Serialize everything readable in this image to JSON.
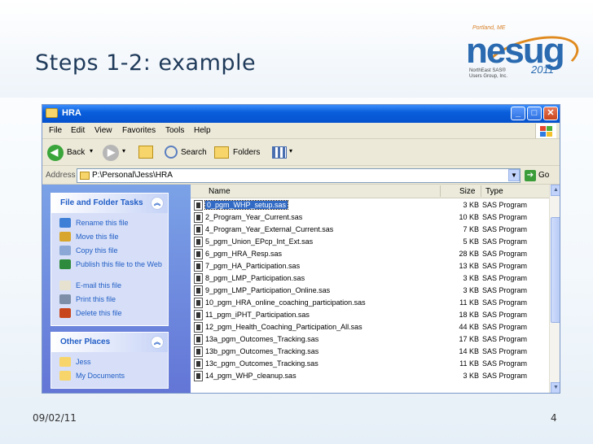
{
  "slide": {
    "title": "Steps 1-2: example",
    "date": "09/02/11",
    "page_number": "4"
  },
  "logo": {
    "city": "Portland, ME",
    "wordmark": "nesug",
    "year": "2011",
    "subtitle_line1": "NorthEast SAS®",
    "subtitle_line2": "Users Group, Inc."
  },
  "window": {
    "title": "HRA",
    "menu": [
      "File",
      "Edit",
      "View",
      "Favorites",
      "Tools",
      "Help"
    ],
    "toolbar": {
      "back": "Back",
      "search": "Search",
      "folders": "Folders"
    },
    "address": {
      "label": "Address",
      "value": "P:\\Personal\\Jess\\HRA",
      "go": "Go"
    },
    "task_panes": [
      {
        "title": "File and Folder Tasks",
        "items": [
          {
            "label": "Rename this file",
            "icon": "rename-icon",
            "color": "#3d7fd6"
          },
          {
            "label": "Move this file",
            "icon": "move-icon",
            "color": "#d8a62c"
          },
          {
            "label": "Copy this file",
            "icon": "copy-icon",
            "color": "#8aa7d6"
          },
          {
            "label": "Publish this file to the Web",
            "icon": "globe-icon",
            "color": "#2e8a3c"
          },
          {
            "label": "E-mail this file",
            "icon": "envelope-icon",
            "color": "#e6e2cf"
          },
          {
            "label": "Print this file",
            "icon": "printer-icon",
            "color": "#7d8fa8"
          },
          {
            "label": "Delete this file",
            "icon": "delete-icon",
            "color": "#c8451c"
          }
        ]
      },
      {
        "title": "Other Places",
        "items": [
          {
            "label": "Jess",
            "icon": "folder-icon",
            "color": "#f7d56b"
          },
          {
            "label": "My Documents",
            "icon": "folder-icon",
            "color": "#f7d56b"
          }
        ]
      }
    ],
    "columns": {
      "name": "Name",
      "size": "Size",
      "type": "Type"
    },
    "files": [
      {
        "name": "0_pgm_WHP_setup.sas",
        "size": "3 KB",
        "type": "SAS Program",
        "selected": true
      },
      {
        "name": "2_Program_Year_Current.sas",
        "size": "10 KB",
        "type": "SAS Program"
      },
      {
        "name": "4_Program_Year_External_Current.sas",
        "size": "7 KB",
        "type": "SAS Program"
      },
      {
        "name": "5_pgm_Union_EPcp_Int_Ext.sas",
        "size": "5 KB",
        "type": "SAS Program"
      },
      {
        "name": "6_pgm_HRA_Resp.sas",
        "size": "28 KB",
        "type": "SAS Program"
      },
      {
        "name": "7_pgm_HA_Participation.sas",
        "size": "13 KB",
        "type": "SAS Program"
      },
      {
        "name": "8_pgm_LMP_Participation.sas",
        "size": "3 KB",
        "type": "SAS Program"
      },
      {
        "name": "9_pgm_LMP_Participation_Online.sas",
        "size": "3 KB",
        "type": "SAS Program"
      },
      {
        "name": "10_pgm_HRA_online_coaching_participation.sas",
        "size": "11 KB",
        "type": "SAS Program"
      },
      {
        "name": "11_pgm_iPHT_Participation.sas",
        "size": "18 KB",
        "type": "SAS Program"
      },
      {
        "name": "12_pgm_Health_Coaching_Participation_All.sas",
        "size": "44 KB",
        "type": "SAS Program"
      },
      {
        "name": "13a_pgm_Outcomes_Tracking.sas",
        "size": "17 KB",
        "type": "SAS Program"
      },
      {
        "name": "13b_pgm_Outcomes_Tracking.sas",
        "size": "14 KB",
        "type": "SAS Program"
      },
      {
        "name": "13c_pgm_Outcomes_Tracking.sas",
        "size": "11 KB",
        "type": "SAS Program"
      },
      {
        "name": "14_pgm_WHP_cleanup.sas",
        "size": "3 KB",
        "type": "SAS Program"
      }
    ]
  }
}
